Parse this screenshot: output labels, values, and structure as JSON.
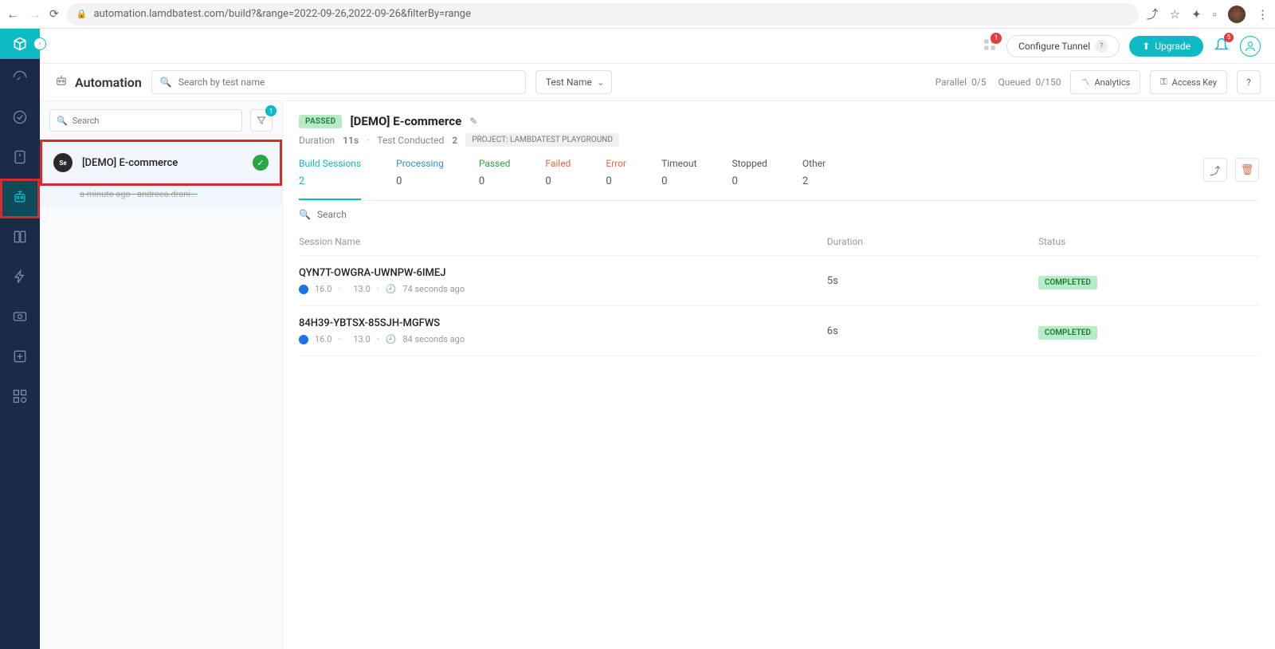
{
  "browser": {
    "url": "automation.lamdbatest.com/build?&range=2022-09-26,2022-09-26&filterBy=range"
  },
  "header": {
    "apps_badge": "1",
    "configure_tunnel": "Configure Tunnel",
    "upgrade": "Upgrade",
    "notif_badge": "5"
  },
  "section": {
    "title": "Automation",
    "search_placeholder": "Search by test name",
    "test_name": "Test Name",
    "parallel_label": "Parallel",
    "parallel_value": "0/5",
    "queued_label": "Queued",
    "queued_value": "0/150",
    "analytics": "Analytics",
    "access_key": "Access Key",
    "help": "?"
  },
  "builds": {
    "search_placeholder": "Search",
    "filter_badge": "1",
    "items": [
      {
        "name": "[DEMO] E-commerce",
        "meta": "a minute ago  ·  andreea.drani..."
      }
    ]
  },
  "detail": {
    "status": "PASSED",
    "title": "[DEMO] E-commerce",
    "duration_label": "Duration",
    "duration_value": "11s",
    "conducted_label": "Test Conducted",
    "conducted_value": "2",
    "project_pill": "PROJECT: LAMBDATEST PLAYGROUND",
    "tabs": [
      {
        "label": "Build Sessions",
        "count": "2",
        "cls": "active"
      },
      {
        "label": "Processing",
        "count": "0",
        "cls": "processing"
      },
      {
        "label": "Passed",
        "count": "0",
        "cls": "passed"
      },
      {
        "label": "Failed",
        "count": "0",
        "cls": "failed"
      },
      {
        "label": "Error",
        "count": "0",
        "cls": "error"
      },
      {
        "label": "Timeout",
        "count": "0",
        "cls": ""
      },
      {
        "label": "Stopped",
        "count": "0",
        "cls": ""
      },
      {
        "label": "Other",
        "count": "2",
        "cls": ""
      }
    ],
    "session_search_placeholder": "Search",
    "columns": {
      "name": "Session Name",
      "duration": "Duration",
      "status": "Status"
    },
    "sessions": [
      {
        "name": "QYN7T-OWGRA-UWNPW-6IMEJ",
        "browser_ver": "16.0",
        "os_ver": "13.0",
        "time": "74 seconds ago",
        "duration": "5s",
        "status": "COMPLETED"
      },
      {
        "name": "84H39-YBTSX-85SJH-MGFWS",
        "browser_ver": "16.0",
        "os_ver": "13.0",
        "time": "84 seconds ago",
        "duration": "6s",
        "status": "COMPLETED"
      }
    ]
  }
}
